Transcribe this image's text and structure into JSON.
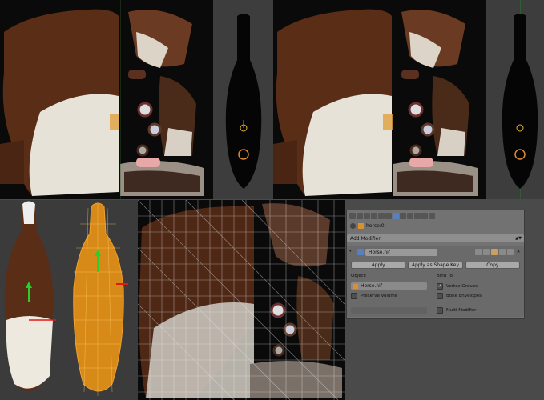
{
  "properties_panel": {
    "breadcrumb_object": "horse:0",
    "add_modifier_label": "Add Modifier",
    "modifier_name": "Horse.nif",
    "buttons": {
      "apply": "Apply",
      "apply_shape_key": "Apply as Shape Key",
      "copy": "Copy"
    },
    "object_label": "Object:",
    "object_value": "Horse.nif",
    "bind_to_label": "Bind To:",
    "checkboxes": {
      "preserve_volume": {
        "label": "Preserve Volume",
        "checked": false
      },
      "vertex_groups": {
        "label": "Vertex Groups",
        "checked": true
      },
      "bone_envelopes": {
        "label": "Bone Envelopes",
        "checked": false
      },
      "multi_modifier": {
        "label": "Multi Modifier",
        "checked": false
      }
    }
  },
  "colors": {
    "uv_background": "#0a0a0a",
    "viewport_background": "#3d3d3d",
    "hide_brown": "#5a2d17",
    "hide_white": "#e6e2d8",
    "wire_orange": "#f0a030",
    "axis_green": "#2ad02a",
    "axis_red": "#e01818",
    "panel_gray": "#727272",
    "active_tab": "#5680c2"
  }
}
